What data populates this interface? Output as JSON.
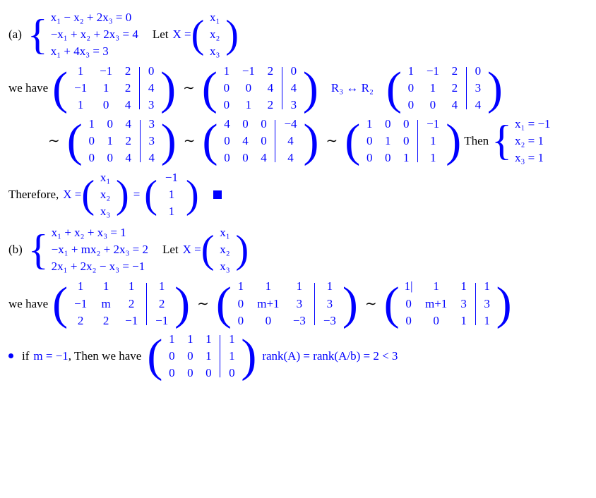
{
  "partA": {
    "label": "(a)",
    "eq1": "x₁ − x₂ + 2x₃ = 0",
    "eq2": "−x₁ + x₂ + 2x₃ = 4",
    "eq3": "x₁ + 4x₃ = 3",
    "let_text": "Let",
    "X_eq": "X =",
    "colX": [
      "x₁",
      "x₂",
      "x₃"
    ],
    "wehave": "we have",
    "m1": {
      "main": [
        [
          "1",
          "−1",
          "2"
        ],
        [
          "−1",
          "1",
          "2"
        ],
        [
          "1",
          "0",
          "4"
        ]
      ],
      "aug": [
        "0",
        "4",
        "3"
      ]
    },
    "m2": {
      "main": [
        [
          "1",
          "−1",
          "2"
        ],
        [
          "0",
          "0",
          "4"
        ],
        [
          "0",
          "1",
          "2"
        ]
      ],
      "aug": [
        "0",
        "4",
        "3"
      ]
    },
    "rowop": "R₃ ↔ R₂",
    "m3": {
      "main": [
        [
          "1",
          "−1",
          "2"
        ],
        [
          "0",
          "1",
          "2"
        ],
        [
          "0",
          "0",
          "4"
        ]
      ],
      "aug": [
        "0",
        "3",
        "4"
      ]
    },
    "m4": {
      "main": [
        [
          "1",
          "0",
          "4"
        ],
        [
          "0",
          "1",
          "2"
        ],
        [
          "0",
          "0",
          "4"
        ]
      ],
      "aug": [
        "3",
        "3",
        "4"
      ]
    },
    "m5": {
      "main": [
        [
          "4",
          "0",
          "0"
        ],
        [
          "0",
          "4",
          "0"
        ],
        [
          "0",
          "0",
          "4"
        ]
      ],
      "aug": [
        "−4",
        "4",
        "4"
      ]
    },
    "m6": {
      "main": [
        [
          "1",
          "0",
          "0"
        ],
        [
          "0",
          "1",
          "0"
        ],
        [
          "0",
          "0",
          "1"
        ]
      ],
      "aug": [
        "−1",
        "1",
        "1"
      ]
    },
    "then_text": "Then",
    "sol": {
      "s1": "x₁ = −1",
      "s2": "x₂ = 1",
      "s3": "x₃ = 1"
    },
    "therefore": "Therefore,",
    "X_eq2": "X =",
    "colX2": [
      "x₁",
      "x₂",
      "x₃"
    ],
    "eq_sign": "=",
    "colSol": [
      "−1",
      "1",
      "1"
    ]
  },
  "partB": {
    "label": "(b)",
    "eq1": "x₁ + x₂ + x₃ = 1",
    "eq2": "−x₁ + mx₂ + 2x₃ = 2",
    "eq3": "2x₁ + 2x₂ − x₃ = −1",
    "let_text": "Let",
    "X_eq": "X =",
    "colX": [
      "x₁",
      "x₂",
      "x₃"
    ],
    "wehave": "we have",
    "m1": {
      "main": [
        [
          "1",
          "1",
          "1"
        ],
        [
          "−1",
          "m",
          "2"
        ],
        [
          "2",
          "2",
          "−1"
        ]
      ],
      "aug": [
        "1",
        "2",
        "−1"
      ]
    },
    "m2": {
      "main": [
        [
          "1",
          "1",
          "1"
        ],
        [
          "0",
          "m+1",
          "3"
        ],
        [
          "0",
          "0",
          "−3"
        ]
      ],
      "aug": [
        "1",
        "3",
        "−3"
      ]
    },
    "m3": {
      "main": [
        [
          "1|",
          "1",
          "1"
        ],
        [
          "0",
          "m+1",
          "3"
        ],
        [
          "0",
          "0",
          "1"
        ]
      ],
      "aug": [
        "1",
        "3",
        "1"
      ]
    },
    "bullet_if": "if",
    "m_cond": "m = −1",
    "bullet_then": ", Then we have",
    "m4": {
      "main": [
        [
          "1",
          "1",
          "1"
        ],
        [
          "0",
          "0",
          "1"
        ],
        [
          "0",
          "0",
          "0"
        ]
      ],
      "aug": [
        "1",
        "1",
        "0"
      ]
    },
    "rank": "rank(A) = rank(A/b) = 2 < 3"
  }
}
